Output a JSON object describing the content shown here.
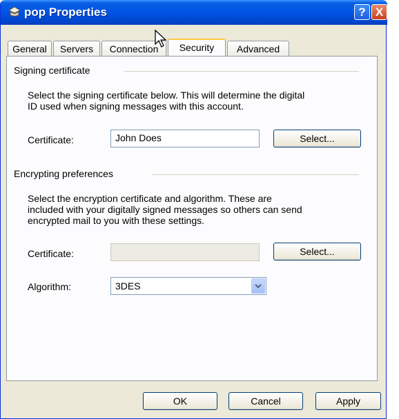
{
  "window": {
    "title": "pop Properties",
    "help_label": "?",
    "close_label": "X"
  },
  "tabs": [
    {
      "label": "General"
    },
    {
      "label": "Servers"
    },
    {
      "label": "Connection"
    },
    {
      "label": "Security",
      "active": true
    },
    {
      "label": "Advanced"
    }
  ],
  "signing": {
    "group_label": "Signing certificate",
    "description_line1": "Select the signing certificate below. This will determine the digital",
    "description_line2": "ID used when signing messages with this account.",
    "certificate_label": "Certificate:",
    "certificate_value": "John Does",
    "select_button": "Select..."
  },
  "encrypting": {
    "group_label": "Encrypting preferences",
    "description_line1": "Select the encryption certificate and algorithm. These are",
    "description_line2": "included with your digitally signed messages so others can send",
    "description_line3": "encrypted mail to you with these settings.",
    "certificate_label": "Certificate:",
    "certificate_value": "",
    "select_button": "Select...",
    "algorithm_label": "Algorithm:",
    "algorithm_value": "3DES"
  },
  "footer": {
    "ok": "OK",
    "cancel": "Cancel",
    "apply": "Apply"
  },
  "colors": {
    "titlebar": "#0055e5",
    "dialog_bg": "#ece9d8",
    "active_tab_accent": "#ffc83c"
  }
}
